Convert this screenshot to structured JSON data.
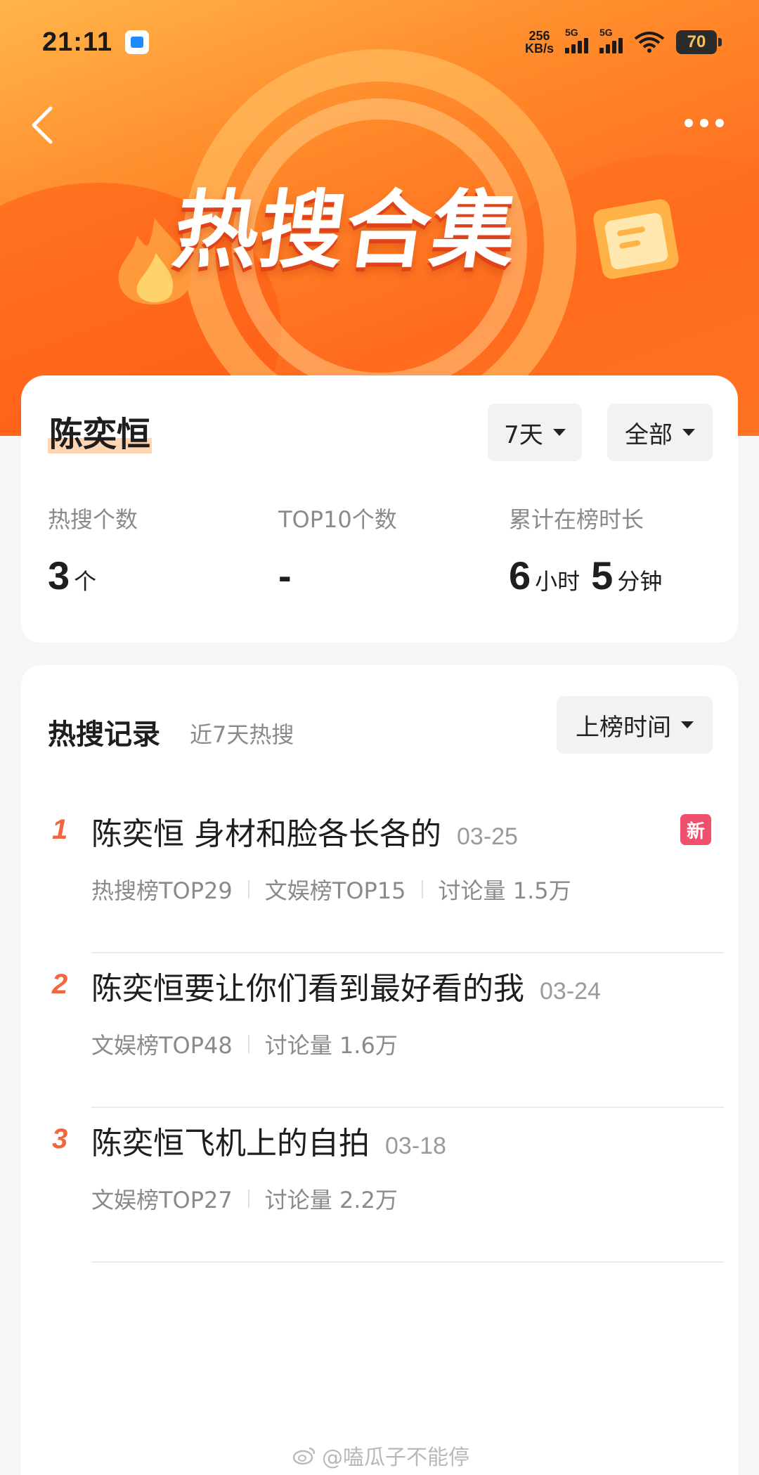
{
  "status_bar": {
    "time": "21:11",
    "net_speed_value": "256",
    "net_speed_unit": "KB/s",
    "sim1": "5G",
    "sim2": "5G",
    "battery": "70"
  },
  "header": {
    "banner_title": "热搜合集"
  },
  "summary": {
    "name": "陈奕恒",
    "filter_period": "7天",
    "filter_scope": "全部",
    "stats": [
      {
        "label": "热搜个数",
        "value": "3",
        "unit": "个"
      },
      {
        "label": "TOP10个数",
        "value": "-"
      },
      {
        "label": "累计在榜时长",
        "hours": "6",
        "hours_unit": "小时",
        "minutes": "5",
        "minutes_unit": "分钟"
      }
    ]
  },
  "records": {
    "title": "热搜记录",
    "subtitle": "近7天热搜",
    "sort_label": "上榜时间",
    "new_badge": "新",
    "items": [
      {
        "rank": "1",
        "title": "陈奕恒 身材和脸各长各的",
        "date": "03-25",
        "meta": [
          "热搜榜TOP29",
          "文娱榜TOP15",
          "讨论量 1.5万"
        ],
        "is_new": true
      },
      {
        "rank": "2",
        "title": "陈奕恒要让你们看到最好看的我",
        "date": "03-24",
        "meta": [
          "文娱榜TOP48",
          "讨论量 1.6万"
        ],
        "is_new": false
      },
      {
        "rank": "3",
        "title": "陈奕恒飞机上的自拍",
        "date": "03-18",
        "meta": [
          "文娱榜TOP27",
          "讨论量 2.2万"
        ],
        "is_new": false
      }
    ]
  },
  "watermark": "@嗑瓜子不能停",
  "colors": {
    "banner_orange": "#ff7a2a",
    "rank_red": "#f2673e",
    "new_badge": "#f0506e",
    "name_highlight": "#ffd6b3"
  }
}
